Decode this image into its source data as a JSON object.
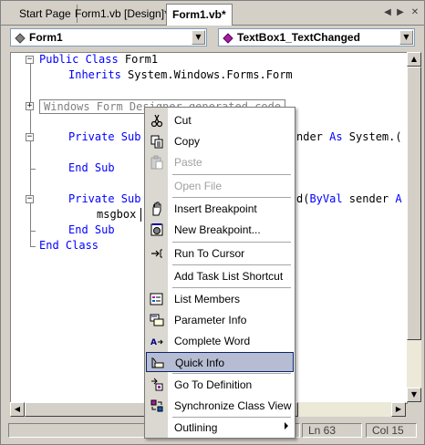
{
  "tabs": [
    {
      "label": "Start Page"
    },
    {
      "label": "Form1.vb [Design]*"
    },
    {
      "label": "Form1.vb*"
    }
  ],
  "nav": {
    "left_icon": "◀",
    "right_icon": "▶",
    "close_icon": "✕"
  },
  "combos": {
    "left": {
      "value": "Form1"
    },
    "right": {
      "value": "TextBox1_TextChanged"
    }
  },
  "code": {
    "l1_kw": "Public Class",
    "l1_rest": " Form1",
    "l2_kw": "Inherits",
    "l2_rest": " System.Windows.Forms.Form",
    "region": "Windows Form Designer generated code",
    "l4_kw": "Private Sub",
    "l4_tail_pre": "nder ",
    "l4_tail_kw": "As",
    "l4_tail_post": " System.(",
    "l5_kw": "End Sub",
    "l6_kw": "Private Sub",
    "l6_tail_pre": "d(",
    "l6_tail_kw": "ByVal",
    "l6_tail_post": " sender ",
    "l6_tail_kw2": "A",
    "l7": "msgbox",
    "l8_kw": "End Sub",
    "l9_kw": "End Class"
  },
  "status": {
    "ln": "Ln 63",
    "col": "Col 15"
  },
  "menu": {
    "items": [
      {
        "label": "Cut",
        "icon": "scissors-icon",
        "disabled": false
      },
      {
        "label": "Copy",
        "icon": "copy-icon",
        "disabled": false
      },
      {
        "label": "Paste",
        "icon": "paste-icon",
        "disabled": true
      },
      {
        "label": "Open File",
        "icon": "",
        "disabled": true
      },
      {
        "label": "Insert Breakpoint",
        "icon": "hand-icon",
        "disabled": false
      },
      {
        "label": "New Breakpoint...",
        "icon": "new-breakpoint-icon",
        "disabled": false
      },
      {
        "label": "Run To Cursor",
        "icon": "run-to-cursor-icon",
        "disabled": false
      },
      {
        "label": "Add Task List Shortcut",
        "icon": "",
        "disabled": false
      },
      {
        "label": "List Members",
        "icon": "list-members-icon",
        "disabled": false
      },
      {
        "label": "Parameter Info",
        "icon": "parameter-info-icon",
        "disabled": false
      },
      {
        "label": "Complete Word",
        "icon": "complete-word-icon",
        "disabled": false
      },
      {
        "label": "Quick Info",
        "icon": "quick-info-icon",
        "disabled": false,
        "highlighted": true
      },
      {
        "label": "Go To Definition",
        "icon": "go-to-definition-icon",
        "disabled": false
      },
      {
        "label": "Synchronize Class View",
        "icon": "synchronize-icon",
        "disabled": false
      },
      {
        "label": "Outlining",
        "icon": "",
        "disabled": false,
        "submenu": true
      }
    ]
  },
  "colors": {
    "keyword": "#0000ff",
    "highlight": "#b6bdd2",
    "highlight_border": "#0a246a"
  }
}
